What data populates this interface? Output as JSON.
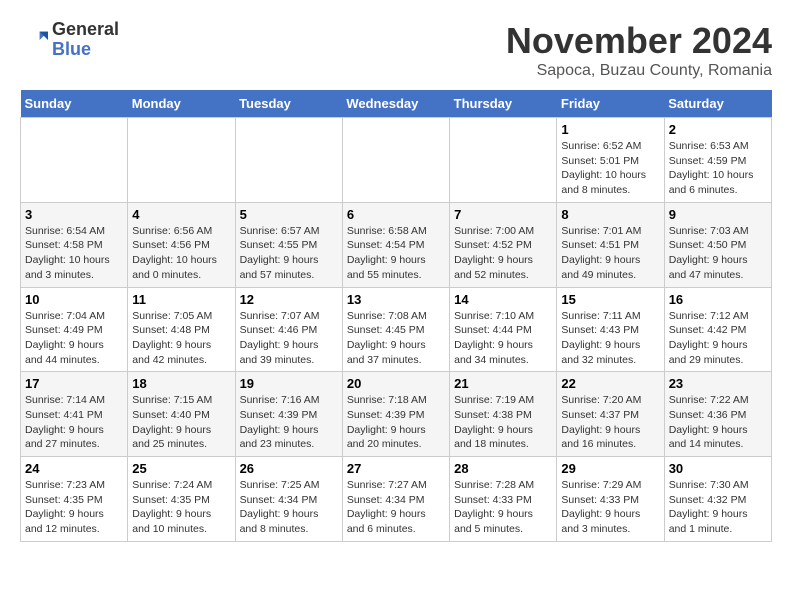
{
  "logo": {
    "general": "General",
    "blue": "Blue"
  },
  "header": {
    "month_title": "November 2024",
    "location": "Sapoca, Buzau County, Romania"
  },
  "weekdays": [
    "Sunday",
    "Monday",
    "Tuesday",
    "Wednesday",
    "Thursday",
    "Friday",
    "Saturday"
  ],
  "weeks": [
    [
      {
        "day": "",
        "info": ""
      },
      {
        "day": "",
        "info": ""
      },
      {
        "day": "",
        "info": ""
      },
      {
        "day": "",
        "info": ""
      },
      {
        "day": "",
        "info": ""
      },
      {
        "day": "1",
        "info": "Sunrise: 6:52 AM\nSunset: 5:01 PM\nDaylight: 10 hours and 8 minutes."
      },
      {
        "day": "2",
        "info": "Sunrise: 6:53 AM\nSunset: 4:59 PM\nDaylight: 10 hours and 6 minutes."
      }
    ],
    [
      {
        "day": "3",
        "info": "Sunrise: 6:54 AM\nSunset: 4:58 PM\nDaylight: 10 hours and 3 minutes."
      },
      {
        "day": "4",
        "info": "Sunrise: 6:56 AM\nSunset: 4:56 PM\nDaylight: 10 hours and 0 minutes."
      },
      {
        "day": "5",
        "info": "Sunrise: 6:57 AM\nSunset: 4:55 PM\nDaylight: 9 hours and 57 minutes."
      },
      {
        "day": "6",
        "info": "Sunrise: 6:58 AM\nSunset: 4:54 PM\nDaylight: 9 hours and 55 minutes."
      },
      {
        "day": "7",
        "info": "Sunrise: 7:00 AM\nSunset: 4:52 PM\nDaylight: 9 hours and 52 minutes."
      },
      {
        "day": "8",
        "info": "Sunrise: 7:01 AM\nSunset: 4:51 PM\nDaylight: 9 hours and 49 minutes."
      },
      {
        "day": "9",
        "info": "Sunrise: 7:03 AM\nSunset: 4:50 PM\nDaylight: 9 hours and 47 minutes."
      }
    ],
    [
      {
        "day": "10",
        "info": "Sunrise: 7:04 AM\nSunset: 4:49 PM\nDaylight: 9 hours and 44 minutes."
      },
      {
        "day": "11",
        "info": "Sunrise: 7:05 AM\nSunset: 4:48 PM\nDaylight: 9 hours and 42 minutes."
      },
      {
        "day": "12",
        "info": "Sunrise: 7:07 AM\nSunset: 4:46 PM\nDaylight: 9 hours and 39 minutes."
      },
      {
        "day": "13",
        "info": "Sunrise: 7:08 AM\nSunset: 4:45 PM\nDaylight: 9 hours and 37 minutes."
      },
      {
        "day": "14",
        "info": "Sunrise: 7:10 AM\nSunset: 4:44 PM\nDaylight: 9 hours and 34 minutes."
      },
      {
        "day": "15",
        "info": "Sunrise: 7:11 AM\nSunset: 4:43 PM\nDaylight: 9 hours and 32 minutes."
      },
      {
        "day": "16",
        "info": "Sunrise: 7:12 AM\nSunset: 4:42 PM\nDaylight: 9 hours and 29 minutes."
      }
    ],
    [
      {
        "day": "17",
        "info": "Sunrise: 7:14 AM\nSunset: 4:41 PM\nDaylight: 9 hours and 27 minutes."
      },
      {
        "day": "18",
        "info": "Sunrise: 7:15 AM\nSunset: 4:40 PM\nDaylight: 9 hours and 25 minutes."
      },
      {
        "day": "19",
        "info": "Sunrise: 7:16 AM\nSunset: 4:39 PM\nDaylight: 9 hours and 23 minutes."
      },
      {
        "day": "20",
        "info": "Sunrise: 7:18 AM\nSunset: 4:39 PM\nDaylight: 9 hours and 20 minutes."
      },
      {
        "day": "21",
        "info": "Sunrise: 7:19 AM\nSunset: 4:38 PM\nDaylight: 9 hours and 18 minutes."
      },
      {
        "day": "22",
        "info": "Sunrise: 7:20 AM\nSunset: 4:37 PM\nDaylight: 9 hours and 16 minutes."
      },
      {
        "day": "23",
        "info": "Sunrise: 7:22 AM\nSunset: 4:36 PM\nDaylight: 9 hours and 14 minutes."
      }
    ],
    [
      {
        "day": "24",
        "info": "Sunrise: 7:23 AM\nSunset: 4:35 PM\nDaylight: 9 hours and 12 minutes."
      },
      {
        "day": "25",
        "info": "Sunrise: 7:24 AM\nSunset: 4:35 PM\nDaylight: 9 hours and 10 minutes."
      },
      {
        "day": "26",
        "info": "Sunrise: 7:25 AM\nSunset: 4:34 PM\nDaylight: 9 hours and 8 minutes."
      },
      {
        "day": "27",
        "info": "Sunrise: 7:27 AM\nSunset: 4:34 PM\nDaylight: 9 hours and 6 minutes."
      },
      {
        "day": "28",
        "info": "Sunrise: 7:28 AM\nSunset: 4:33 PM\nDaylight: 9 hours and 5 minutes."
      },
      {
        "day": "29",
        "info": "Sunrise: 7:29 AM\nSunset: 4:33 PM\nDaylight: 9 hours and 3 minutes."
      },
      {
        "day": "30",
        "info": "Sunrise: 7:30 AM\nSunset: 4:32 PM\nDaylight: 9 hours and 1 minute."
      }
    ]
  ]
}
